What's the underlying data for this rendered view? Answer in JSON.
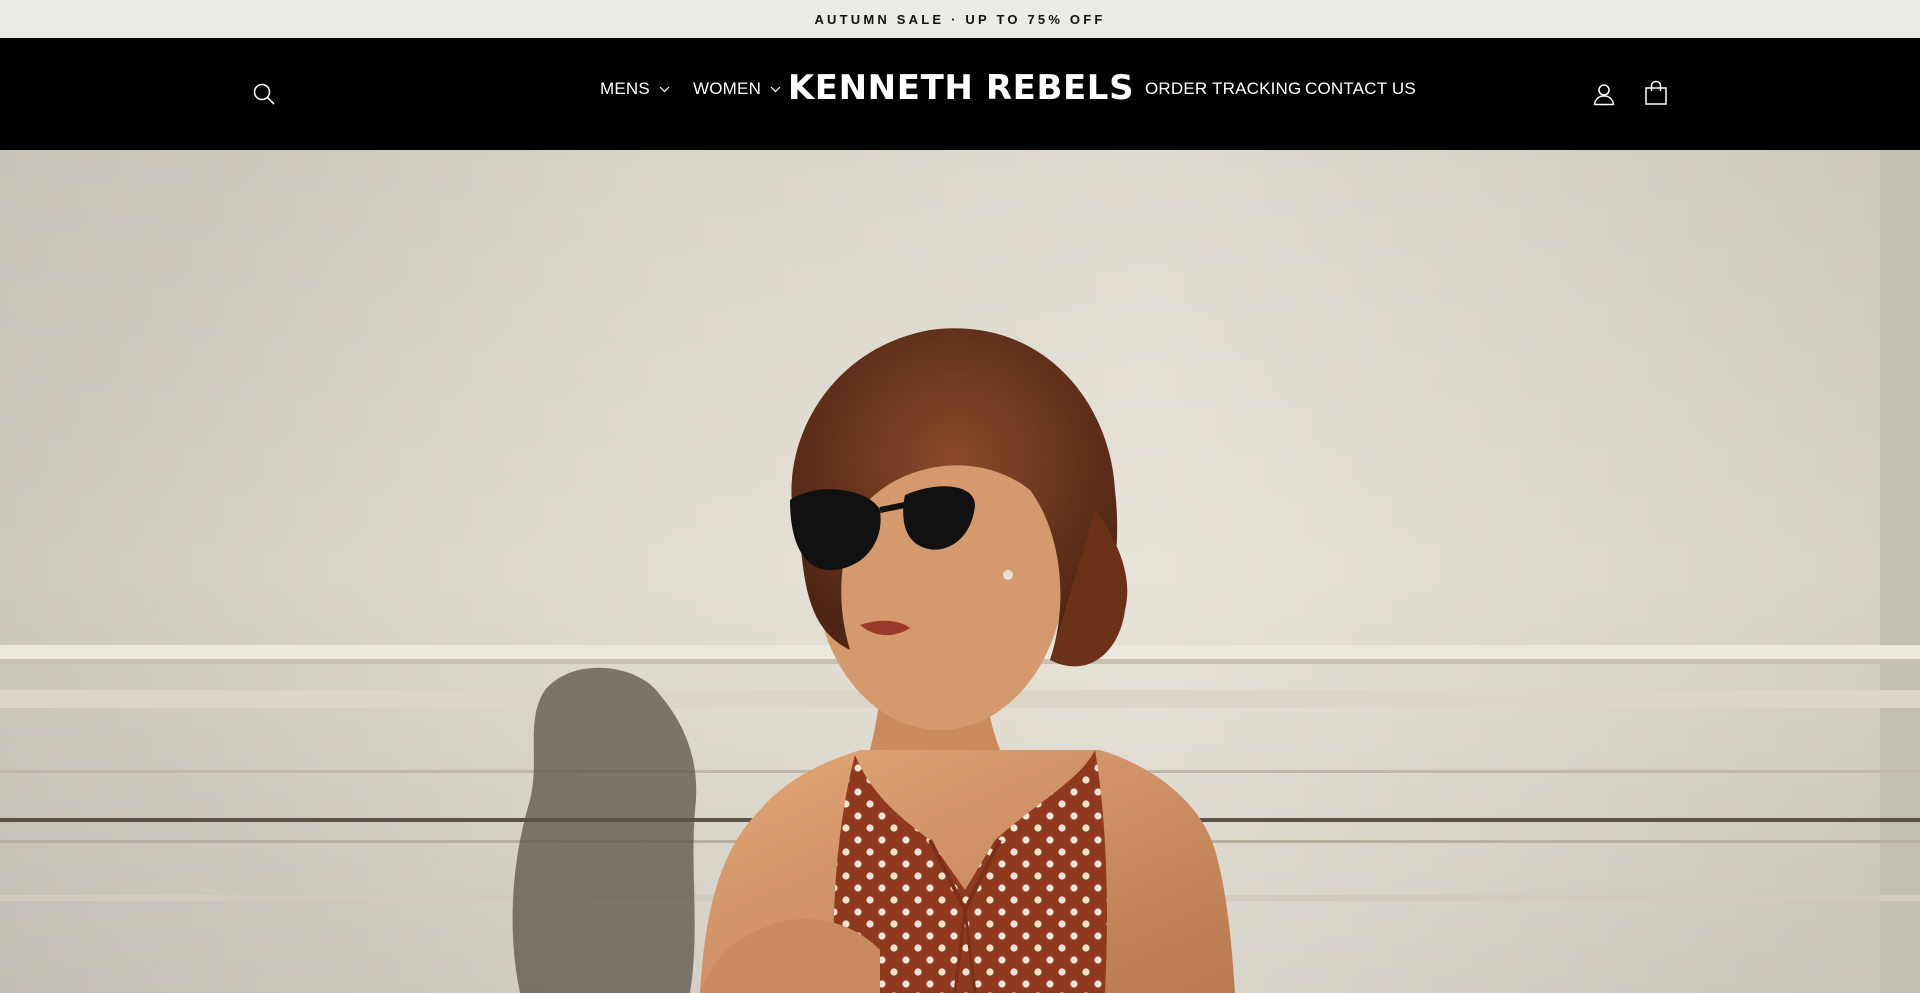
{
  "announcement": {
    "text": "AUTUMN SALE · UP TO 75% OFF"
  },
  "header": {
    "logo": "KENNETH REBELS",
    "nav_left": [
      {
        "label": "MENS",
        "has_dropdown": true
      },
      {
        "label": "WOMEN",
        "has_dropdown": true
      }
    ],
    "nav_right": [
      {
        "label": "ORDER TRACKING"
      },
      {
        "label": "CONTACT US"
      }
    ],
    "icons": {
      "search": "search-icon",
      "account": "user-icon",
      "cart": "shopping-bag-icon"
    }
  },
  "colors": {
    "announcement_bg": "#ebeae5",
    "header_bg": "#000000",
    "header_text": "#ffffff"
  }
}
